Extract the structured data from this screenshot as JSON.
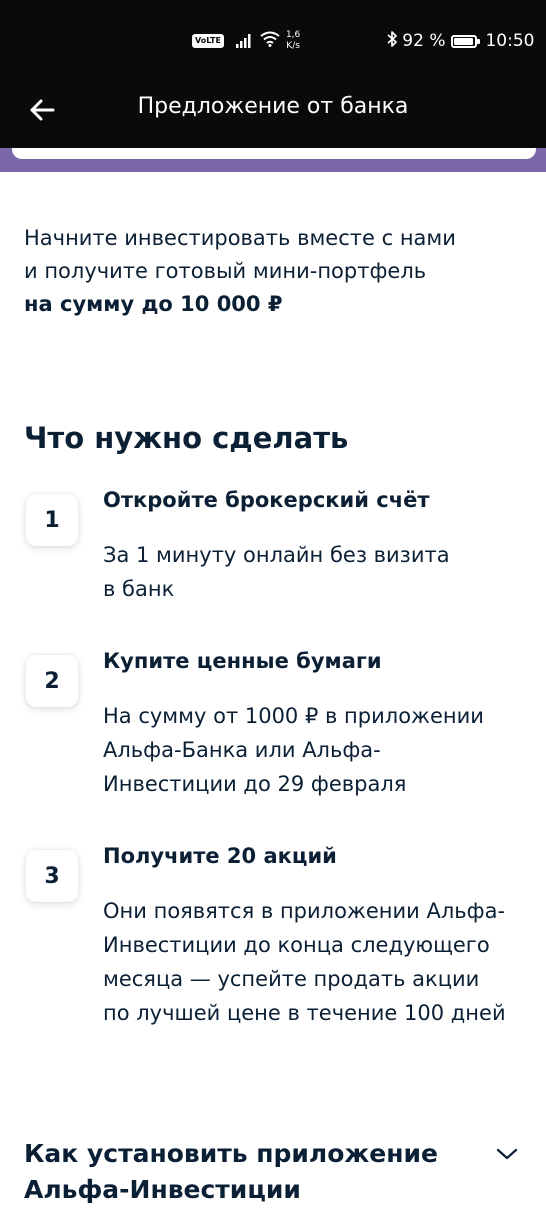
{
  "status_bar": {
    "volte": "VoLTE",
    "speed_value": "1,6",
    "speed_unit": "K/s",
    "battery_percent": "92 %",
    "battery_level": 0.92,
    "time": "10:50"
  },
  "header": {
    "title": "Предложение от банка",
    "background": "#0a0a0a"
  },
  "accent": {
    "purple": "#7b68a8",
    "text": "#0b1f35"
  },
  "intro": {
    "line1": "Начните инвестировать вместе с нами",
    "line2": "и получите готовый мини-портфель",
    "bold": "на сумму до 10 000 ₽"
  },
  "section": {
    "title": "Что нужно сделать"
  },
  "steps": [
    {
      "number": "1",
      "title": "Откройте брокерский счёт",
      "desc_lines": [
        "За 1 минуту онлайн без визита",
        "в банк"
      ]
    },
    {
      "number": "2",
      "title": "Купите ценные бумаги",
      "desc_lines": [
        "На сумму от 1000 ₽ в приложении",
        "Альфа-Банка или Альфа-",
        "Инвестиции до 29 февраля"
      ]
    },
    {
      "number": "3",
      "title": "Получите 20 акций",
      "desc_lines": [
        "Они появятся в приложении Альфа-",
        "Инвестиции до конца следующего",
        "месяца — успейте продать акции",
        "по лучшей цене в течение 100 дней"
      ]
    }
  ],
  "accordion": {
    "title_line1": "Как установить приложение",
    "title_line2": "Альфа-Инвестиции",
    "icon": "chevron-down-icon"
  }
}
